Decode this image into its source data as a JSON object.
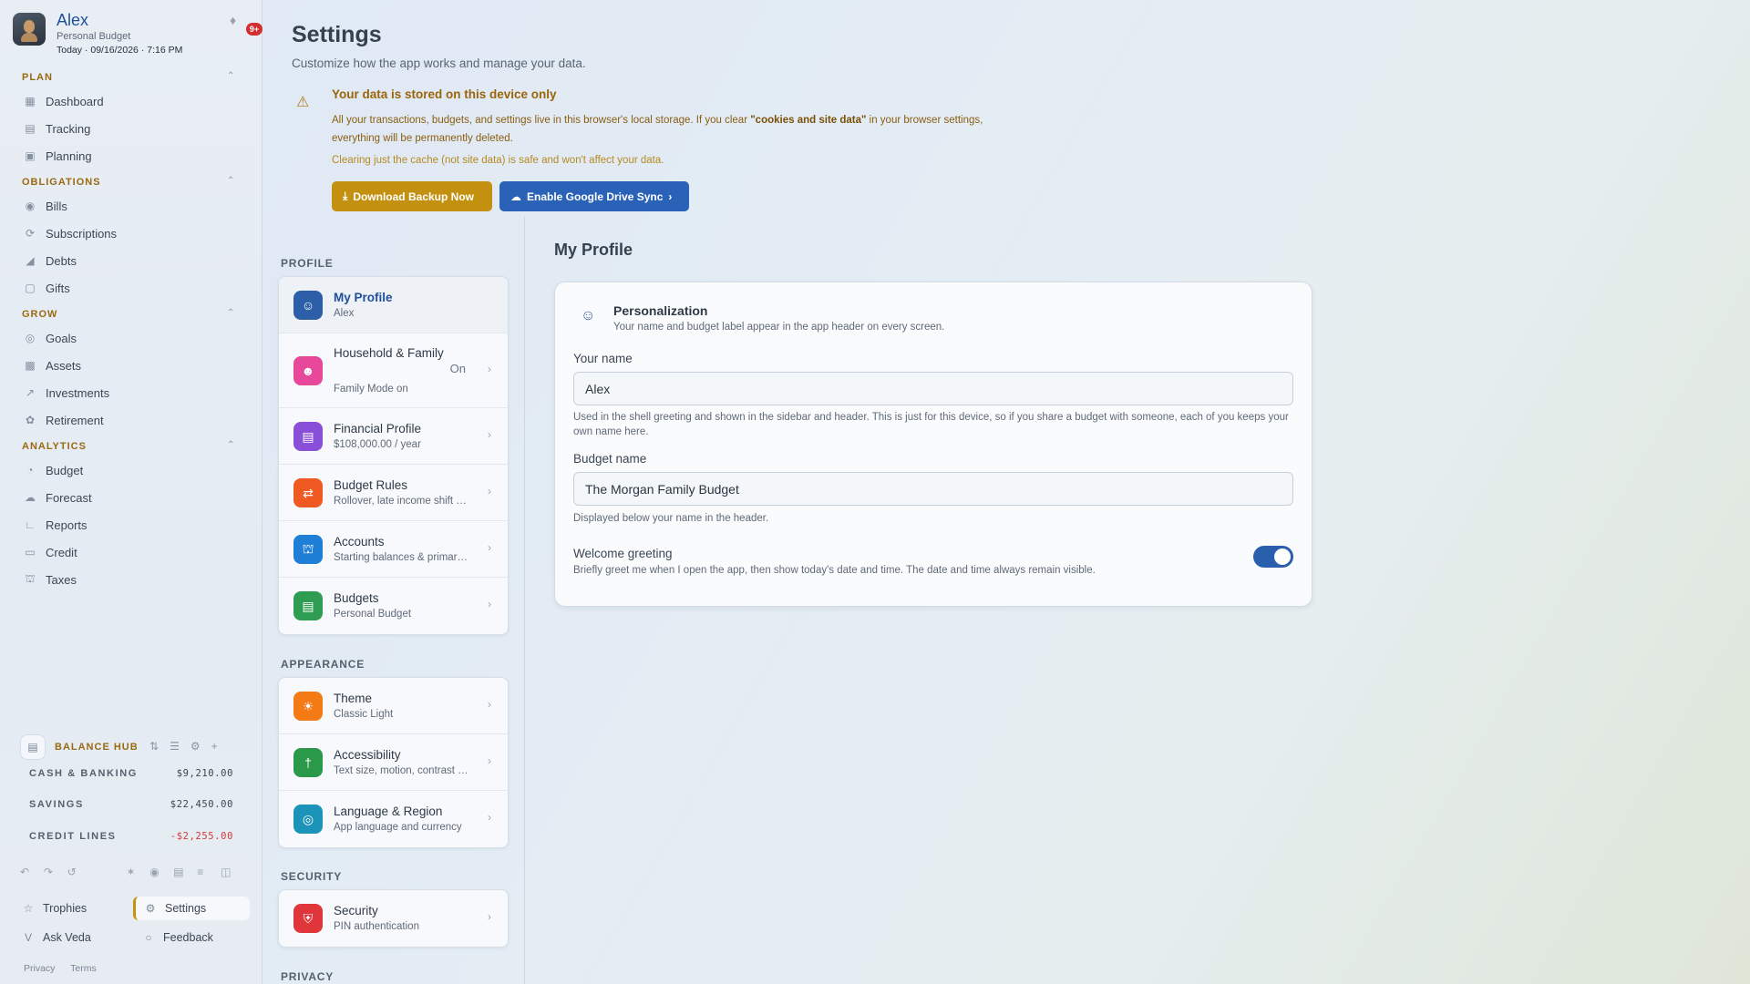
{
  "user": {
    "name": "Alex",
    "budget_label": "Personal Budget",
    "datetime": "Today · 09/16/2026 · 7:16 PM",
    "notification_count": "9+"
  },
  "sidebar": {
    "sections": [
      {
        "title": "PLAN",
        "items": [
          {
            "label": "Dashboard",
            "icon": "grid-icon"
          },
          {
            "label": "Tracking",
            "icon": "receipt-icon"
          },
          {
            "label": "Planning",
            "icon": "calendar-icon"
          }
        ]
      },
      {
        "title": "OBLIGATIONS",
        "items": [
          {
            "label": "Bills",
            "icon": "bill-icon"
          },
          {
            "label": "Subscriptions",
            "icon": "refresh-icon"
          },
          {
            "label": "Debts",
            "icon": "debt-icon"
          },
          {
            "label": "Gifts",
            "icon": "gift-icon"
          }
        ]
      },
      {
        "title": "GROW",
        "items": [
          {
            "label": "Goals",
            "icon": "target-icon"
          },
          {
            "label": "Assets",
            "icon": "building-icon"
          },
          {
            "label": "Investments",
            "icon": "trend-icon"
          },
          {
            "label": "Retirement",
            "icon": "seedling-icon"
          }
        ]
      },
      {
        "title": "ANALYTICS",
        "items": [
          {
            "label": "Budget",
            "icon": "pie-icon"
          },
          {
            "label": "Forecast",
            "icon": "forecast-icon"
          },
          {
            "label": "Reports",
            "icon": "chart-icon"
          },
          {
            "label": "Credit",
            "icon": "card-icon"
          },
          {
            "label": "Taxes",
            "icon": "bank-icon"
          }
        ]
      }
    ]
  },
  "balance_hub": {
    "title": "BALANCE HUB",
    "rows": [
      {
        "label": "CASH & BANKING",
        "amount": "$9,210.00"
      },
      {
        "label": "SAVINGS",
        "amount": "$22,450.00"
      },
      {
        "label": "CREDIT LINES",
        "amount": "-$2,255.00"
      }
    ]
  },
  "footer_nav": {
    "trophies": "Trophies",
    "settings": "Settings",
    "ask_veda": "Ask Veda",
    "feedback": "Feedback",
    "privacy": "Privacy",
    "terms": "Terms"
  },
  "page": {
    "title": "Settings",
    "subtitle": "Customize how the app works and manage your data."
  },
  "warning": {
    "title": "Your data is stored on this device only",
    "body_pre": "All your transactions, budgets, and settings live in this browser's local storage. If you clear ",
    "body_bold": "\"cookies and site data\"",
    "body_post": " in your browser settings, everything will be permanently deleted.",
    "note": "Clearing just the cache (not site data) is safe and won't affect your data.",
    "backup_button": "Download Backup Now",
    "sync_button": "Enable Google Drive Sync"
  },
  "settings_nav": {
    "profile_label": "PROFILE",
    "appearance_label": "APPEARANCE",
    "security_label": "SECURITY",
    "privacy_label": "PRIVACY",
    "profile_items": [
      {
        "title": "My Profile",
        "sub": "Alex",
        "color": "#2d5fa8",
        "icon": "user-icon"
      },
      {
        "title": "Household & Family",
        "sub": "Family Mode on",
        "status": "On",
        "color": "#e8489a",
        "icon": "family-icon"
      },
      {
        "title": "Financial Profile",
        "sub": "$108,000.00 / year",
        "color": "#8a4fd8",
        "icon": "briefcase-icon"
      },
      {
        "title": "Budget Rules",
        "sub": "Rollover, late income shift & more",
        "color": "#ef5a22",
        "icon": "swap-icon"
      },
      {
        "title": "Accounts",
        "sub": "Starting balances & primary account",
        "color": "#1f7ed6",
        "icon": "bank-icon"
      },
      {
        "title": "Budgets",
        "sub": "Personal Budget",
        "color": "#2e9d52",
        "icon": "wallet-icon"
      }
    ],
    "appearance_items": [
      {
        "title": "Theme",
        "sub": "Classic Light",
        "color": "#f47a16",
        "icon": "sun-icon"
      },
      {
        "title": "Accessibility",
        "sub": "Text size, motion, contrast & more",
        "color": "#2a9a4a",
        "icon": "accessibility-icon"
      },
      {
        "title": "Language & Region",
        "sub": "App language and currency",
        "color": "#1c93b8",
        "icon": "globe-icon"
      }
    ],
    "security_items": [
      {
        "title": "Security",
        "sub": "PIN authentication",
        "color": "#e0353a",
        "icon": "shield-icon"
      }
    ]
  },
  "profile_panel": {
    "section_title": "My Profile",
    "card_title": "Personalization",
    "card_sub": "Your name and budget label appear in the app header on every screen.",
    "name_label": "Your name",
    "name_value": "Alex",
    "name_help": "Used in the shell greeting and shown in the sidebar and header. This is just for this device, so if you share a budget with someone, each of you keeps your own name here.",
    "budget_label": "Budget name",
    "budget_value": "The Morgan Family Budget",
    "budget_help": "Displayed below your name in the header.",
    "greeting_title": "Welcome greeting",
    "greeting_sub": "Briefly greet me when I open the app, then show today's date and time. The date and time always remain visible.",
    "greeting_enabled": true
  }
}
